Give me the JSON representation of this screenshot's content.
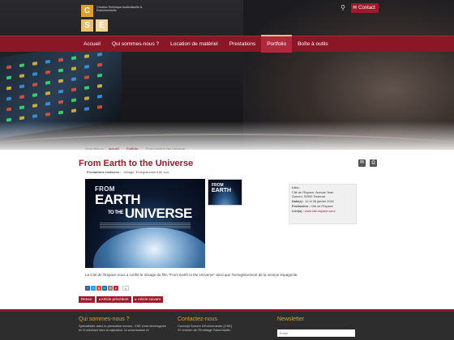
{
  "logo": {
    "letter_c": "C",
    "letter_s": "S",
    "letter_e": "E",
    "tagline": "Création Technique Audiovisuelle & Evénementielle"
  },
  "topbar": {
    "icons": [
      "lock-icon",
      "twitter-icon",
      "facebook-icon",
      "search-icon"
    ],
    "contact_label": "Contact"
  },
  "nav": {
    "items": [
      {
        "label": "Accueil",
        "active": false
      },
      {
        "label": "Qui sommes-nous ?",
        "active": false
      },
      {
        "label": "Location de matériel",
        "active": false
      },
      {
        "label": "Prestations",
        "active": false
      },
      {
        "label": "Portfolio",
        "active": true
      },
      {
        "label": "Boîte à outils",
        "active": false
      }
    ]
  },
  "breadcrumb": {
    "prefix": "Vous êtes ici :",
    "items": [
      "Accueil",
      "Portfolio",
      "From Earth to the Universe"
    ]
  },
  "article": {
    "title": "From Earth to the Universe",
    "meta_label": "Prestations réalisées :",
    "meta_value": "Mixage, Enregistrement de voix",
    "poster_line1": "FROM",
    "poster_line2": "EARTH",
    "poster_line3": "UNIVERSE",
    "poster_to": "TO THE",
    "thumb_line1": "FROM",
    "thumb_line2": "EARTH",
    "description": "La Cité de l'Espace nous a confié le mixage du film \"From Earth to the Universe\" ainsi que l'enregistrement de la version espagnole."
  },
  "info": {
    "lieu_label": "Lieu :",
    "lieu_value_1": "Cité de l'Espace, Avenue Jean",
    "lieu_value_2": "Gonord, 31500 Toulouse",
    "dates_label": "Date(s) :",
    "dates_value": "12 et 26 janvier 2016",
    "production_label": "Production :",
    "production_value": "Cité de l'Espace",
    "lien_label": "Lien(s) :",
    "lien_value": "www.cite-espace.com/"
  },
  "share": {
    "buttons": [
      {
        "label": "f",
        "color": "#3b5998"
      },
      {
        "label": "t",
        "color": "#1da1f2"
      },
      {
        "label": "g",
        "color": "#dd4b39"
      },
      {
        "label": "in",
        "color": "#0077b5"
      },
      {
        "label": "@",
        "color": "#7a7a7a"
      },
      {
        "label": "p",
        "color": "#cb2027"
      }
    ],
    "count": "0"
  },
  "article_buttons": {
    "back": "Retour",
    "prev": "◂ Article précédent",
    "next": "▸ Article suivant"
  },
  "footer": {
    "col1_title": "Qui sommes-nous ?",
    "col1_line1": "Spécialisée dans la prestation sonore, CSE s'est développée",
    "col1_line2": "en s'orientant vers la captation, la sonorisation et",
    "col2_title": "Contactez-nous",
    "col2_line1": "Concept Sonore d'Evénements (CSE)",
    "col2_line2": "22 chemin de l'Ermitage Saint-Martin",
    "col3_title": "Newsletter",
    "newsletter_placeholder": "Email"
  },
  "colors": {
    "brand": "#9c1a2a",
    "nav": "#8a1626",
    "accent": "#e0a030"
  }
}
